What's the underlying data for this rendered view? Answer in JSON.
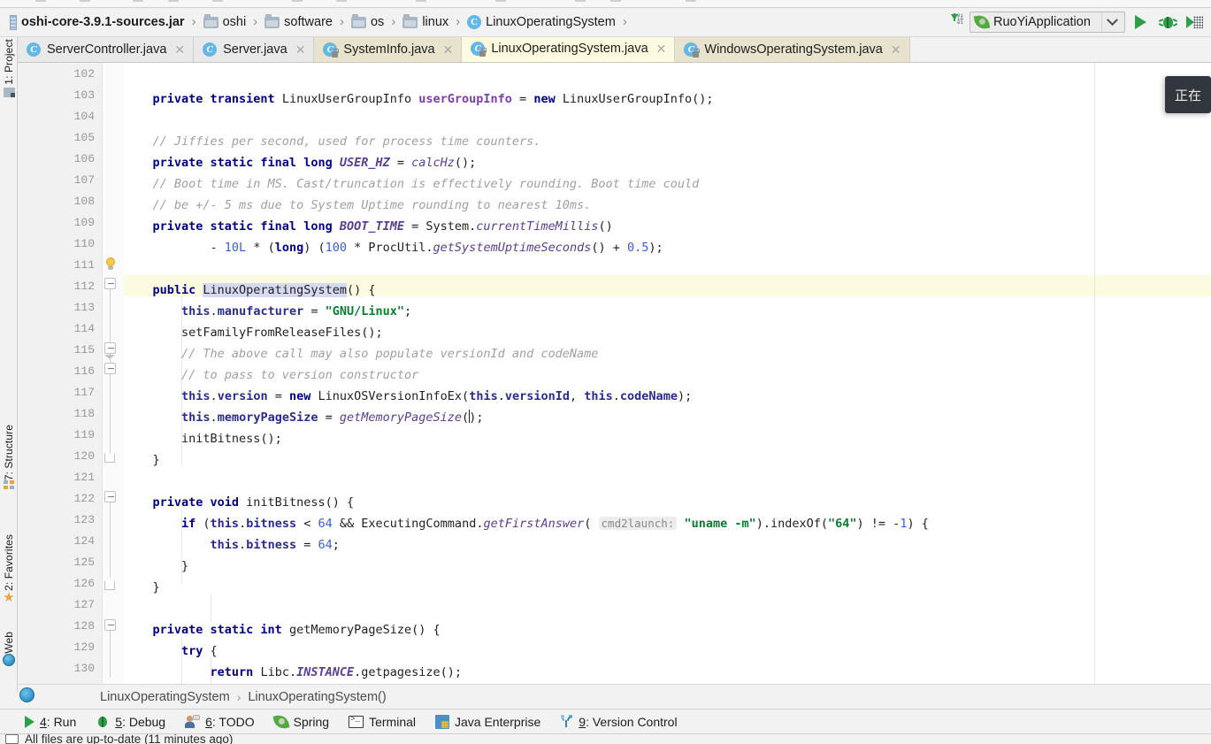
{
  "window": {
    "app": "IntelliJ IDEA"
  },
  "navbar": {
    "crumbs": [
      {
        "icon": "jar-icon",
        "label": "oshi-core-3.9.1-sources.jar",
        "bold": true
      },
      {
        "icon": "folder-icon",
        "label": "oshi",
        "bold": false
      },
      {
        "icon": "folder-icon",
        "label": "software",
        "bold": false
      },
      {
        "icon": "folder-icon",
        "label": "os",
        "bold": false
      },
      {
        "icon": "folder-icon",
        "label": "linux",
        "bold": false
      },
      {
        "icon": "class-icon",
        "label": "LinuxOperatingSystem",
        "bold": false
      }
    ],
    "separator": "›",
    "class_glyph": "C",
    "download_icon": "download-dependencies-icon",
    "download_bits": [
      "01",
      "10",
      "01"
    ],
    "run_config": {
      "name": "RuoYiApplication",
      "icon": "spring-leaf-icon",
      "chevron": "chevron-down-icon"
    },
    "actions": [
      {
        "name": "run-button",
        "icon": "play-icon"
      },
      {
        "name": "debug-button",
        "icon": "bug-icon"
      },
      {
        "name": "coverage-button",
        "icon": "run-with-coverage-icon"
      }
    ]
  },
  "tabs": [
    {
      "label": "ServerController.java",
      "state": "normal",
      "locked": false,
      "glyph": "C"
    },
    {
      "label": "Server.java",
      "state": "normal",
      "locked": false,
      "glyph": "C"
    },
    {
      "label": "SystemInfo.java",
      "state": "modified",
      "locked": true,
      "glyph": "C"
    },
    {
      "label": "LinuxOperatingSystem.java",
      "state": "active",
      "locked": true,
      "glyph": "C"
    },
    {
      "label": "WindowsOperatingSystem.java",
      "state": "beige",
      "locked": true,
      "glyph": "C"
    }
  ],
  "tab_close_glyph": "✕",
  "left_strip": [
    {
      "name": "sidebar-item-project",
      "label": "1: Project",
      "mnemonic": "1",
      "icon": "project-icon"
    },
    {
      "name": "sidebar-item-structure",
      "label": "7: Structure",
      "mnemonic": "7",
      "icon": "structure-icon"
    },
    {
      "name": "sidebar-item-favorites",
      "label": "2: Favorites",
      "mnemonic": "2",
      "icon": "star-icon"
    },
    {
      "name": "sidebar-item-web",
      "label": "Web",
      "mnemonic": "",
      "icon": "web-icon"
    }
  ],
  "editor": {
    "file": "LinuxOperatingSystem.java",
    "first_line": 102,
    "highlighted_line": 112,
    "caret_line": 118,
    "lines": [
      {
        "n": 102,
        "indent": 0
      },
      {
        "n": 103,
        "indent": 0
      },
      {
        "n": 104,
        "indent": 0
      },
      {
        "n": 105,
        "indent": 0
      },
      {
        "n": 106,
        "indent": 0
      },
      {
        "n": 107,
        "indent": 0
      },
      {
        "n": 108,
        "indent": 0
      },
      {
        "n": 109,
        "indent": 0
      },
      {
        "n": 110,
        "indent": 0
      },
      {
        "n": 111,
        "indent": 0
      },
      {
        "n": 112,
        "indent": 0
      },
      {
        "n": 113,
        "indent": 0
      },
      {
        "n": 114,
        "indent": 0
      },
      {
        "n": 115,
        "indent": 0
      },
      {
        "n": 116,
        "indent": 0
      },
      {
        "n": 117,
        "indent": 0
      },
      {
        "n": 118,
        "indent": 0
      },
      {
        "n": 119,
        "indent": 0
      },
      {
        "n": 120,
        "indent": 0
      },
      {
        "n": 121,
        "indent": 0
      },
      {
        "n": 122,
        "indent": 0
      },
      {
        "n": 123,
        "indent": 0
      },
      {
        "n": 124,
        "indent": 0
      },
      {
        "n": 125,
        "indent": 0
      },
      {
        "n": 126,
        "indent": 0
      },
      {
        "n": 127,
        "indent": 0
      },
      {
        "n": 128,
        "indent": 0
      },
      {
        "n": 129,
        "indent": 0
      },
      {
        "n": 130,
        "indent": 0
      }
    ],
    "code_text": [
      "",
      "    private transient LinuxUserGroupInfo userGroupInfo = new LinuxUserGroupInfo();",
      "",
      "    // Jiffies per second, used for process time counters.",
      "    private static final long USER_HZ = calcHz();",
      "    // Boot time in MS. Cast/truncation is effectively rounding. Boot time could",
      "    // be +/- 5 ms due to System Uptime rounding to nearest 10ms.",
      "    private static final long BOOT_TIME = System.currentTimeMillis()",
      "            - 10L * (long) (100 * ProcUtil.getSystemUptimeSeconds() + 0.5);",
      "",
      "    public LinuxOperatingSystem() {",
      "        this.manufacturer = \"GNU/Linux\";",
      "        setFamilyFromReleaseFiles();",
      "        // The above call may also populate versionId and codeName",
      "        // to pass to version constructor",
      "        this.version = new LinuxOSVersionInfoEx(this.versionId, this.codeName);",
      "        this.memoryPageSize = getMemoryPageSize();",
      "        initBitness();",
      "    }",
      "",
      "    private void initBitness() {",
      "        if (this.bitness < 64 && ExecutingCommand.getFirstAnswer( cmd2launch: \"uname -m\").indexOf(\"64\") != -1) {",
      "            this.bitness = 64;",
      "        }",
      "    }",
      "",
      "    private static int getMemoryPageSize() {",
      "        try {",
      "            return Libc.INSTANCE.getpagesize();"
    ],
    "inlay_hint": "cmd2launch:",
    "gutter_bulb": "intention-bulb-icon"
  },
  "tooltip": {
    "text": "正在"
  },
  "editor_breadcrumb": {
    "items": [
      "LinuxOperatingSystem",
      "LinuxOperatingSystem()"
    ],
    "separator": "›"
  },
  "bottom_bar": [
    {
      "name": "tool-window-run",
      "mnemonic": "4",
      "label": ": Run",
      "icon": "play-icon"
    },
    {
      "name": "tool-window-debug",
      "mnemonic": "5",
      "label": ": Debug",
      "icon": "bug-icon"
    },
    {
      "name": "tool-window-todo",
      "mnemonic": "6",
      "label": ": TODO",
      "icon": "todo-icon"
    },
    {
      "name": "tool-window-spring",
      "mnemonic": "",
      "label": "Spring",
      "icon": "spring-leaf-icon"
    },
    {
      "name": "tool-window-terminal",
      "mnemonic": "",
      "label": "Terminal",
      "icon": "terminal-icon"
    },
    {
      "name": "tool-window-java-enterprise",
      "mnemonic": "",
      "label": "Java Enterprise",
      "icon": "java-enterprise-icon"
    },
    {
      "name": "tool-window-version-control",
      "mnemonic": "9",
      "label": ": Version Control",
      "icon": "version-control-icon"
    }
  ],
  "statusbar": {
    "message": "All files are up-to-date (11 minutes ago)"
  },
  "colors": {
    "accent_blue": "#63b8e8",
    "green": "#2e9e4a",
    "active_tab_bg": "#fdfbdf",
    "beige_tab_bg": "#e8e3cd",
    "keyword": "#000080",
    "string": "#0a7c2f",
    "comment": "#a0a0a0",
    "number": "#3b5ed6",
    "static_field": "#5a3e8f",
    "instance_field": "#7b3fa8",
    "tooltip_bg": "#32373d"
  }
}
